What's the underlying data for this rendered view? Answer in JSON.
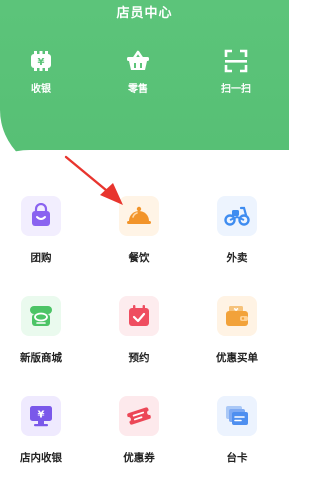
{
  "header": {
    "title": "店员中心",
    "quick_actions": [
      {
        "label": "收银",
        "icon": "cashier-icon"
      },
      {
        "label": "零售",
        "icon": "basket-icon"
      },
      {
        "label": "扫一扫",
        "icon": "scan-icon"
      }
    ]
  },
  "grid": [
    {
      "label": "团购",
      "icon": "group-buy-bag-icon"
    },
    {
      "label": "餐饮",
      "icon": "cloche-icon"
    },
    {
      "label": "外卖",
      "icon": "scooter-icon"
    },
    {
      "label": "新版商城",
      "icon": "store-icon"
    },
    {
      "label": "预约",
      "icon": "calendar-check-icon"
    },
    {
      "label": "优惠买单",
      "icon": "wallet-icon"
    },
    {
      "label": "店内收银",
      "icon": "monitor-yen-icon"
    },
    {
      "label": "优惠券",
      "icon": "coupon-ticket-icon"
    },
    {
      "label": "台卡",
      "icon": "cards-stack-icon"
    }
  ],
  "colors": {
    "header_green": "#5cc47a",
    "arrow_red": "#e8352e",
    "group_buy_purple": "#8a63f0",
    "dining_orange": "#f2942a",
    "delivery_blue": "#3e8cf0",
    "store_green": "#4cc466",
    "booking_red": "#ef4d60",
    "discount_orange": "#f2a23a",
    "cashier_purple": "#7a58ea",
    "coupon_red": "#ec4757",
    "card_blue": "#4e8ff0"
  }
}
